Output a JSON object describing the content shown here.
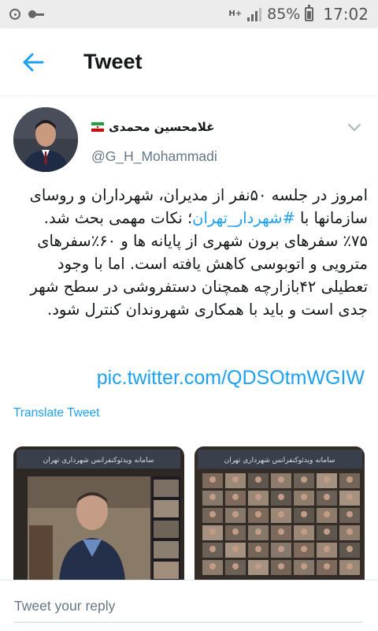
{
  "status_bar": {
    "network": "H+",
    "battery": "85%",
    "battery_level": 0.85,
    "time": "17:02"
  },
  "app_bar": {
    "back_icon": "arrow-left-icon",
    "title": "Tweet"
  },
  "tweet": {
    "author": {
      "name": "غلامحسین محمدی",
      "handle": "@G_H_Mohammadi",
      "flag_icon": "iran-flag-icon"
    },
    "text_before_hashtag": "امروز در جلسه ۵۰نفر از مدیران، شهرداران و روسای سازمانها با ",
    "hashtag": "#شهردار_تهران",
    "text_after_hashtag": "؛ نکات مهمی بحث شد. ۷۵٪ سفرهای برون شهری از پایانه ها و ۶۰٪سفرهای مترویی و اتوبوسی کاهش یافته است. اما با وجود تعطیلی ۴۲بازارچه همچنان دستفروشی در سطح شهر جدی است و باید با همکاری شهروندان کنترل شود.",
    "link": "pic.twitter.com/QDSOtmWGIW",
    "translate_label": "Translate Tweet",
    "media_caption": "سامانه ویدئوکنفرانس شهرداری تهران"
  },
  "reply": {
    "placeholder": "Tweet your reply"
  },
  "colors": {
    "accent": "#1da1f2",
    "text": "#14171a",
    "secondary": "#657786",
    "status_bg": "#ececec"
  }
}
